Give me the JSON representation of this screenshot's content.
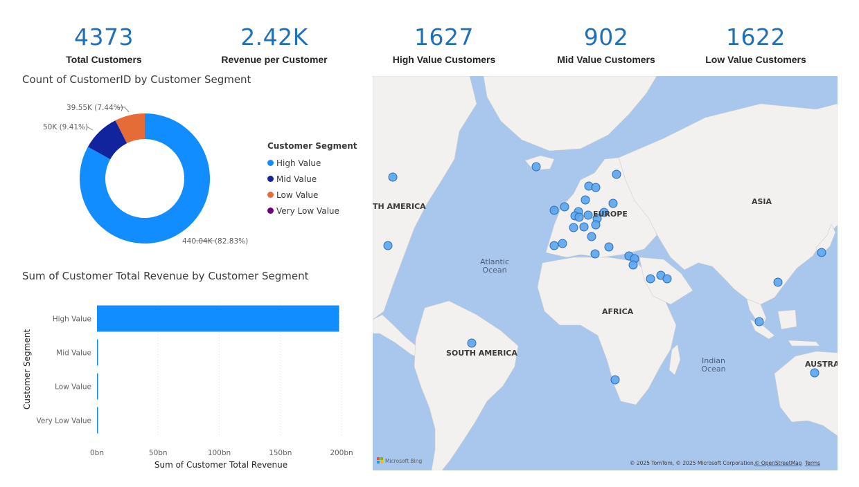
{
  "kpis": [
    {
      "value": "4373",
      "label": "Total Customers"
    },
    {
      "value": "2.42K",
      "label": "Revenue per Customer"
    },
    {
      "value": "1627",
      "label": "High Value Customers"
    },
    {
      "value": "902",
      "label": "Mid Value Customers"
    },
    {
      "value": "1622",
      "label": "Low Value Customers"
    }
  ],
  "donut": {
    "title": "Count of CustomerID by Customer Segment",
    "legend_title": "Customer Segment",
    "labels": {
      "high": "440.04K (82.83%)",
      "mid": "50K (9.41%)",
      "low": "39.55K (7.44%)"
    }
  },
  "legend": [
    {
      "name": "High Value",
      "color": "#118dff"
    },
    {
      "name": "Mid Value",
      "color": "#12239e"
    },
    {
      "name": "Low Value",
      "color": "#e66c37"
    },
    {
      "name": "Very Low Value",
      "color": "#6b007b"
    }
  ],
  "bar": {
    "title": "Sum of Customer Total Revenue by Customer Segment",
    "xlabel": "Sum of Customer Total Revenue",
    "ylabel": "Customer Segment"
  },
  "map": {
    "labels": {
      "north_america": "TH AMERICA",
      "europe": "EUROPE",
      "asia": "ASIA",
      "atlantic1": "Atlantic",
      "atlantic2": "Ocean",
      "africa": "AFRICA",
      "south_america": "SOUTH AMERICA",
      "indian1": "Indian",
      "indian2": "Ocean",
      "australia": "AUSTRAL"
    },
    "attribution": "© 2025 TomTom, © 2025 Microsoft Corporation,",
    "osm_link": "© OpenStreetMap",
    "terms_link": "Terms",
    "bing": "Microsoft Bing",
    "point_color": "#5ba4ef"
  },
  "chart_data": [
    {
      "type": "pie",
      "title": "Count of CustomerID by Customer Segment",
      "categories": [
        "High Value",
        "Mid Value",
        "Low Value",
        "Very Low Value"
      ],
      "values": [
        440040,
        50000,
        39550,
        0
      ],
      "percent": [
        82.83,
        9.41,
        7.44,
        0
      ],
      "colors": [
        "#118dff",
        "#12239e",
        "#e66c37",
        "#6b007b"
      ],
      "legend": "right"
    },
    {
      "type": "bar",
      "orientation": "horizontal",
      "title": "Sum of Customer Total Revenue by Customer Segment",
      "categories": [
        "High Value",
        "Mid Value",
        "Low Value",
        "Very Low Value"
      ],
      "values": [
        198,
        0.8,
        0.5,
        0.2
      ],
      "xlabel": "Sum of Customer Total Revenue",
      "ylabel": "Customer Segment",
      "xlim": [
        0,
        200
      ],
      "xticks": [
        "0bn",
        "50bn",
        "100bn",
        "150bn",
        "200bn"
      ],
      "color": "#118dff",
      "grid": true
    }
  ]
}
